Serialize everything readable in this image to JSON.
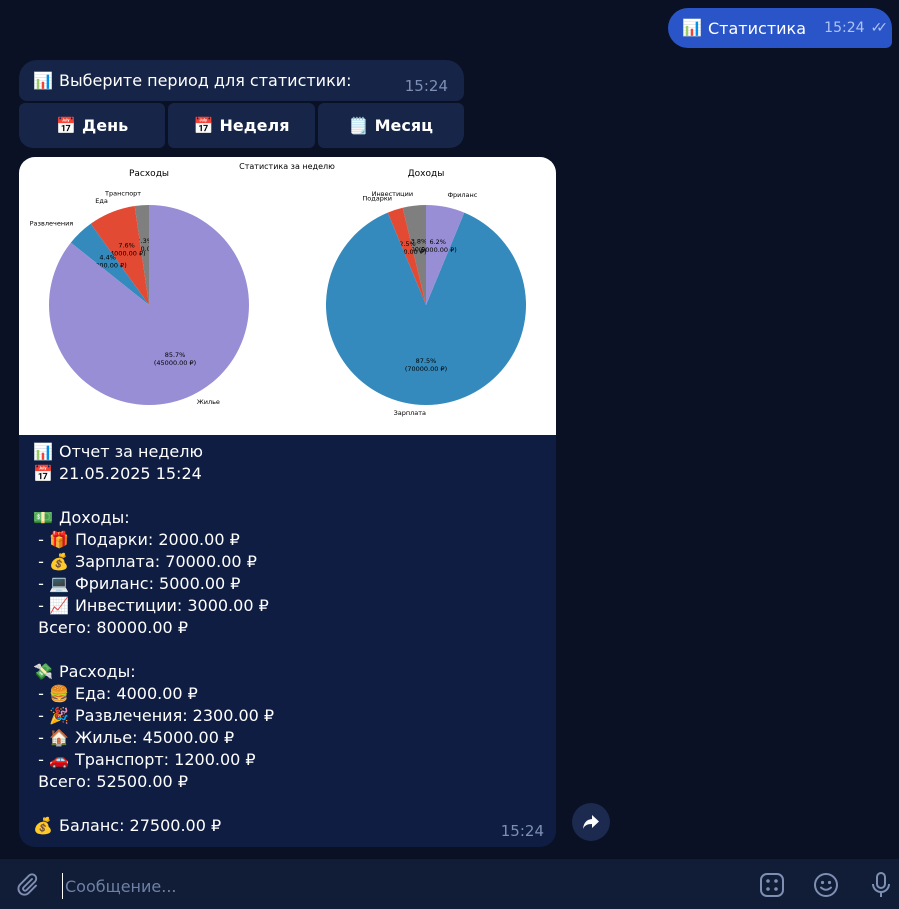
{
  "outgoing": {
    "icon": "bar-chart-emoji",
    "text": "Статистика",
    "time": "15:24",
    "ticks": "✓✓"
  },
  "period_prompt": {
    "icon": "bar-chart-emoji",
    "text": "Выберите период для статистики:",
    "time": "15:24"
  },
  "period_buttons": [
    {
      "icon": "calendar-emoji",
      "label": "День"
    },
    {
      "icon": "calendar-emoji",
      "label": "Неделя"
    },
    {
      "icon": "notepad-emoji",
      "label": "Месяц"
    }
  ],
  "chart_data": [
    {
      "type": "pie",
      "suptitle": "Статистика за неделю",
      "title": "Расходы",
      "slices": [
        {
          "label": "Транспорт",
          "value": 1200,
          "pct": "2.3%",
          "amount": "(1200.00 ₽)",
          "color": "#7f7f7f"
        },
        {
          "label": "Еда",
          "value": 4000,
          "pct": "7.6%",
          "amount": "(4000.00 ₽)",
          "color": "#e24a33"
        },
        {
          "label": "Развлечения",
          "value": 2300,
          "pct": "4.4%",
          "amount": "(2300.00 ₽)",
          "color": "#348abd"
        },
        {
          "label": "Жилье",
          "value": 45000,
          "pct": "85.7%",
          "amount": "(45000.00 ₽)",
          "color": "#988ed5"
        }
      ]
    },
    {
      "type": "pie",
      "title": "Доходы",
      "slices": [
        {
          "label": "Инвестиции",
          "value": 3000,
          "pct": "3.8%",
          "amount": "(3000.00 ₽)",
          "color": "#7f7f7f"
        },
        {
          "label": "Подарки",
          "value": 2000,
          "pct": "2.5%",
          "amount": "(2000.00 ₽)",
          "color": "#e24a33"
        },
        {
          "label": "Зарплата",
          "value": 70000,
          "pct": "87.5%",
          "amount": "(70000.00 ₽)",
          "color": "#348abd"
        },
        {
          "label": "Фриланс",
          "value": 5000,
          "pct": "6.2%",
          "amount": "(5000.00 ₽)",
          "color": "#988ed5"
        }
      ]
    }
  ],
  "report": {
    "lines": [
      {
        "icon": "bar-chart-emoji",
        "emoji": "📊",
        "text": "Отчет за неделю"
      },
      {
        "icon": "calendar-emoji",
        "emoji": "📅",
        "text": "21.05.2025 15:24"
      },
      {
        "icon": "",
        "emoji": "",
        "text": ""
      },
      {
        "icon": "money-emoji",
        "emoji": "💵",
        "text": "Доходы:"
      },
      {
        "icon": "gift-emoji",
        "emoji": "🎁",
        "text": "Подарки: 2000.00 ₽",
        "prefix": " - "
      },
      {
        "icon": "moneybag-emoji",
        "emoji": "💰",
        "text": "Зарплата: 70000.00 ₽",
        "prefix": " - "
      },
      {
        "icon": "laptop-emoji",
        "emoji": "💻",
        "text": "Фриланс: 5000.00 ₽",
        "prefix": " - "
      },
      {
        "icon": "chart-up-emoji",
        "emoji": "📈",
        "text": "Инвестиции: 3000.00 ₽",
        "prefix": " - "
      },
      {
        "icon": "",
        "emoji": "",
        "text": "Всего: 80000.00 ₽",
        "prefix": " "
      },
      {
        "icon": "",
        "emoji": "",
        "text": ""
      },
      {
        "icon": "money-wings-emoji",
        "emoji": "💸",
        "text": "Расходы:"
      },
      {
        "icon": "burger-emoji",
        "emoji": "🍔",
        "text": "Еда: 4000.00 ₽",
        "prefix": " - "
      },
      {
        "icon": "party-emoji",
        "emoji": "🎉",
        "text": "Развлечения: 2300.00 ₽",
        "prefix": " - "
      },
      {
        "icon": "house-emoji",
        "emoji": "🏠",
        "text": "Жилье: 45000.00 ₽",
        "prefix": " - "
      },
      {
        "icon": "car-emoji",
        "emoji": "🚗",
        "text": "Транспорт: 1200.00 ₽",
        "prefix": " - "
      },
      {
        "icon": "",
        "emoji": "",
        "text": "Всего: 52500.00 ₽",
        "prefix": " "
      },
      {
        "icon": "",
        "emoji": "",
        "text": ""
      },
      {
        "icon": "moneybag-emoji",
        "emoji": "💰",
        "text": "Баланс: 27500.00 ₽"
      }
    ],
    "time": "15:24"
  },
  "input": {
    "placeholder": "Сообщение..."
  },
  "colors": {
    "background": "#0a1124",
    "outgoing": "#2a55c8",
    "incoming": "#162447",
    "input_bar": "#111c36"
  }
}
